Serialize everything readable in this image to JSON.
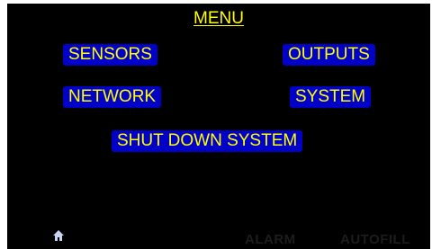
{
  "menu": {
    "title": "MENU",
    "buttons": {
      "sensors": "SENSORS",
      "outputs": "OUTPUTS",
      "network": "NETWORK",
      "system": "SYSTEM",
      "shutdown": "SHUT DOWN SYSTEM"
    }
  },
  "status_bar": {
    "home_icon": "home-icon",
    "alarm": "ALARM",
    "autofill": "AUTOFILL"
  },
  "colors": {
    "background": "#000000",
    "button_bg": "#0000c8",
    "text": "#ffff00",
    "status_dim": "#1c1c1c"
  }
}
